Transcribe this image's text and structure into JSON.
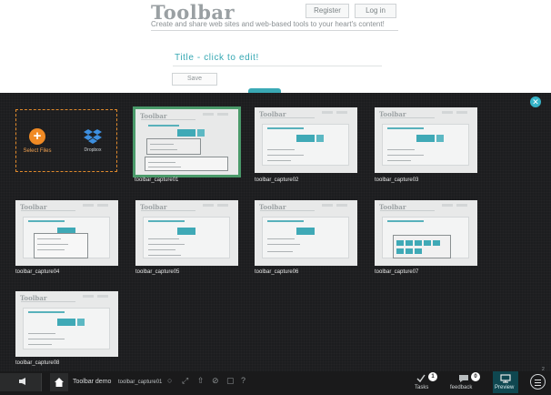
{
  "app": {
    "brand": "Toolbar",
    "tagline": "Create and share web sites and web-based tools to your heart's content!",
    "register_label": "Register",
    "login_label": "Log in",
    "title_placeholder": "Title - click to edit!",
    "save_label": "Save"
  },
  "uploader": {
    "select_files_label": "Select Files",
    "dropbox_label": "Dropbox",
    "close_icon": "close-icon",
    "accent_color": "#e08a2c",
    "selected_color": "#4a9a6a"
  },
  "captures": [
    {
      "name": "toolbar_capture01",
      "selected": true
    },
    {
      "name": "toolbar_capture02",
      "selected": false
    },
    {
      "name": "toolbar_capture03",
      "selected": false
    },
    {
      "name": "toolbar_capture04",
      "selected": false
    },
    {
      "name": "toolbar_capture05",
      "selected": false
    },
    {
      "name": "toolbar_capture06",
      "selected": false
    },
    {
      "name": "toolbar_capture07",
      "selected": false
    },
    {
      "name": "toolbar_capture08",
      "selected": false
    }
  ],
  "bottombar": {
    "site_name": "Toolbar demo",
    "page_name": "toolbar_capture01",
    "tool_icons": [
      "circle-icon",
      "expand-icon",
      "upload-icon",
      "disabled-icon",
      "window-icon",
      "help-icon"
    ],
    "tasks_label": "Tasks",
    "tasks_count": "1",
    "feedback_label": "feedback",
    "feedback_count": "0",
    "preview_label": "Preview",
    "accent_color": "#0f4750"
  }
}
